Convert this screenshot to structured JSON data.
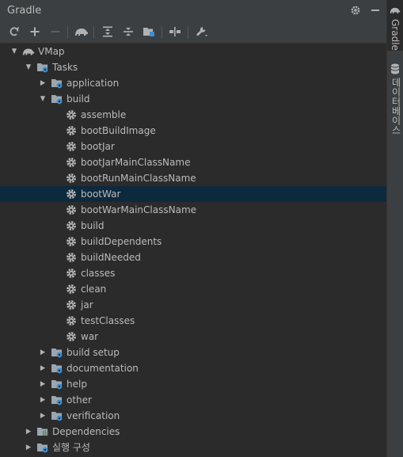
{
  "panel": {
    "title": "Gradle"
  },
  "header_icons": [
    "gear-icon",
    "minimize-icon"
  ],
  "toolbar": {
    "buttons": [
      {
        "name": "reload-all-gradle-projects-button",
        "icon": "refresh-icon"
      },
      {
        "name": "link-gradle-project-button",
        "icon": "plus-icon"
      },
      {
        "name": "unlink-gradle-project-button",
        "icon": "minus-icon",
        "enabled": false
      },
      {
        "name": "execute-gradle-task-button",
        "icon": "gradle-elephant-icon"
      },
      {
        "name": "expand-all-button",
        "icon": "expand-all-icon"
      },
      {
        "name": "collapse-all-button",
        "icon": "collapse-all-icon"
      },
      {
        "name": "group-tasks-button",
        "icon": "folder-group-icon"
      },
      {
        "name": "toggle-offline-mode-button",
        "icon": "offline-icon"
      },
      {
        "name": "build-tool-settings-button",
        "icon": "wrench-icon"
      }
    ]
  },
  "tree": {
    "root": "VMap",
    "tasks": "Tasks",
    "application": "application",
    "build": "build",
    "build_tasks": [
      "assemble",
      "bootBuildImage",
      "bootJar",
      "bootJarMainClassName",
      "bootRunMainClassName",
      "bootWar",
      "bootWarMainClassName",
      "build",
      "buildDependents",
      "buildNeeded",
      "classes",
      "clean",
      "jar",
      "testClasses",
      "war"
    ],
    "selected_task": "bootWar",
    "groups_after": [
      "build setup",
      "documentation",
      "help",
      "other",
      "verification"
    ],
    "dependencies": "Dependencies",
    "run_configs": "실행 구성"
  },
  "sidebar": {
    "tabs": [
      {
        "label": "Gradle",
        "active": true
      },
      {
        "label": "데이터베이스",
        "active": false
      }
    ]
  },
  "colors": {
    "panel_bg": "#2b2b2b",
    "toolbar_bg": "#3c3f41",
    "selection_bg": "#0d293e",
    "text": "#bbbbbb",
    "folder_gear_blue": "#3d8fd1",
    "deps_green": "#6a8759"
  }
}
